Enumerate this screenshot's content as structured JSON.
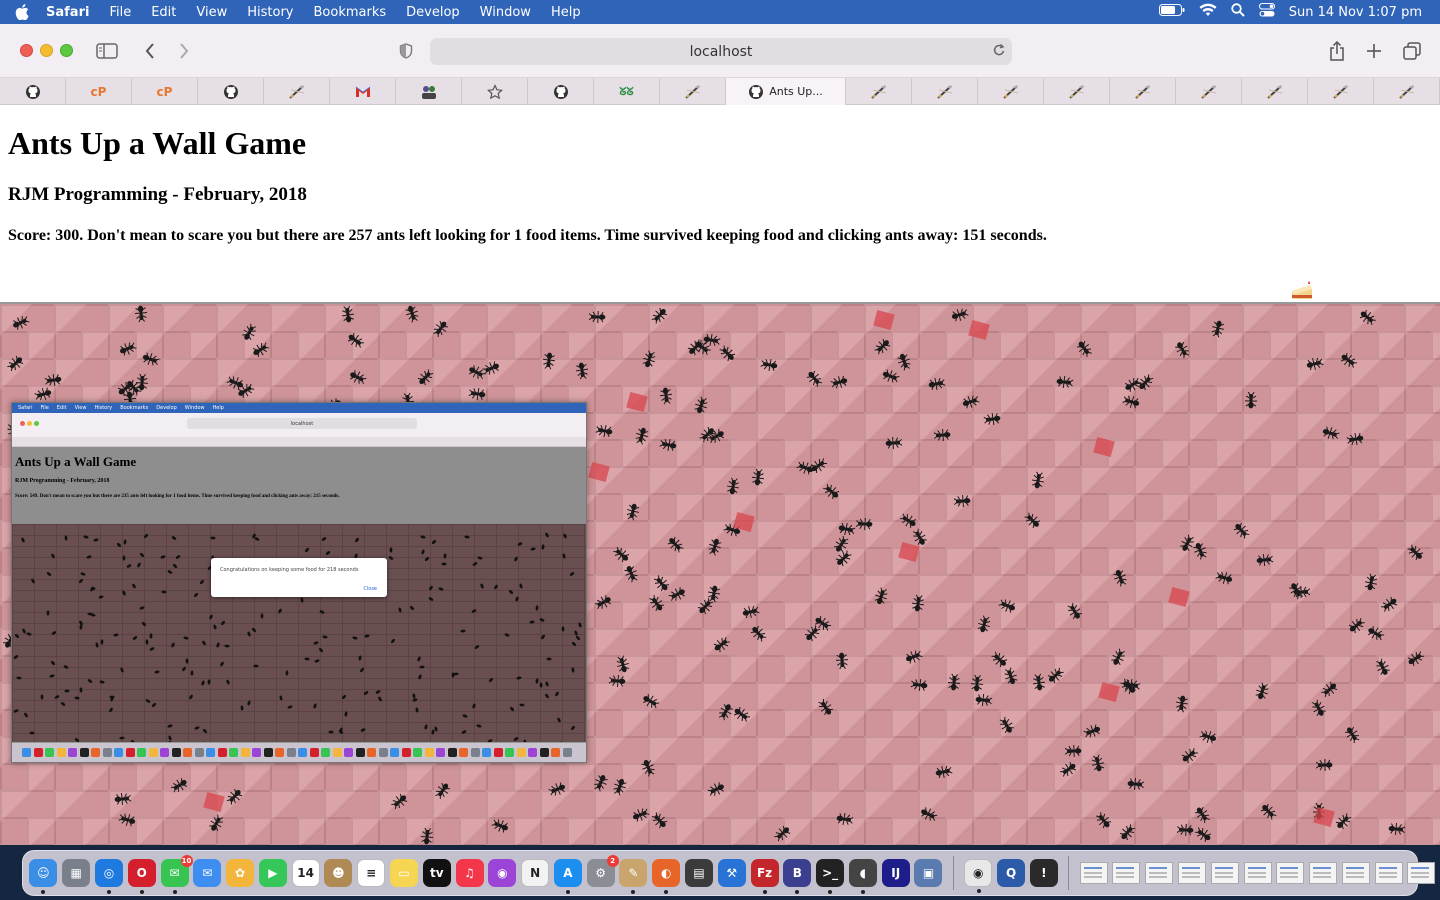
{
  "menubar": {
    "app": "Safari",
    "items": [
      "File",
      "Edit",
      "View",
      "History",
      "Bookmarks",
      "Develop",
      "Window",
      "Help"
    ],
    "datetime": "Sun 14 Nov  1:07 pm"
  },
  "toolbar": {
    "url": "localhost"
  },
  "tabs": [
    {
      "icon": "github-icon"
    },
    {
      "icon": "cpanel-icon",
      "text": "cP"
    },
    {
      "icon": "cpanel-icon",
      "text": "cP"
    },
    {
      "icon": "github-icon"
    },
    {
      "icon": "pencil-favicon-icon"
    },
    {
      "icon": "gmail-icon"
    },
    {
      "icon": "people-icon"
    },
    {
      "icon": "star-icon"
    },
    {
      "icon": "github-icon"
    },
    {
      "icon": "geeksforgeeks-icon"
    },
    {
      "icon": "pencil-favicon-icon"
    },
    {
      "icon": "github-icon",
      "label": "Ants Up...",
      "active": true
    },
    {
      "icon": "pencil-favicon-icon"
    },
    {
      "icon": "pencil-favicon-icon"
    },
    {
      "icon": "pencil-favicon-icon"
    },
    {
      "icon": "pencil-favicon-icon"
    },
    {
      "icon": "pencil-favicon-icon"
    },
    {
      "icon": "pencil-favicon-icon"
    },
    {
      "icon": "pencil-favicon-icon"
    },
    {
      "icon": "pencil-favicon-icon"
    },
    {
      "icon": "pencil-favicon-icon"
    }
  ],
  "page": {
    "title": "Ants Up a Wall Game",
    "subtitle": "RJM Programming - February, 2018",
    "score_text": "Score: 300. Don't mean to scare you but there are 257 ants left looking for 1 food items. Time survived keeping food and clicking ants away: 151 seconds.",
    "wall_color": "#d69a9f",
    "ant_color": "#1a1a1a"
  },
  "embedded_screenshot": {
    "menubar_items": [
      "Safari",
      "File",
      "Edit",
      "View",
      "History",
      "Bookmarks",
      "Develop",
      "Window",
      "Help"
    ],
    "url": "localhost",
    "title": "Ants Up a Wall Game",
    "subtitle": "RJM Programming - February, 2018",
    "score_text": "Score: 549. Don't mean to scare you but there are 235 ants left looking for 1 food items. Time survived keeping food and clicking ants away: 215 seconds.",
    "dialog_message": "Congratulations on keeping some food for 218 seconds",
    "dialog_close": "Close"
  },
  "dock": {
    "apps": [
      {
        "name": "finder-icon",
        "color": "#3a8ee6",
        "glyph": "☺",
        "running": true
      },
      {
        "name": "launchpad-icon",
        "color": "#7a7f8c",
        "glyph": "▦"
      },
      {
        "name": "safari-icon",
        "color": "#1f7ae0",
        "glyph": "◎",
        "running": true
      },
      {
        "name": "opera-icon",
        "color": "#d3202c",
        "glyph": "O",
        "running": true
      },
      {
        "name": "messages-icon",
        "color": "#37c453",
        "glyph": "✉",
        "badge": "10",
        "running": true
      },
      {
        "name": "mail-icon",
        "color": "#3d8ef0",
        "glyph": "✉"
      },
      {
        "name": "photos-icon",
        "color": "#f3b53c",
        "glyph": "✿"
      },
      {
        "name": "facetime-icon",
        "color": "#35c759",
        "glyph": "▶"
      },
      {
        "name": "calendar-icon",
        "color": "#ffffff",
        "glyph": "14",
        "dark_text": true
      },
      {
        "name": "contacts-icon",
        "color": "#b08a55",
        "glyph": "☻"
      },
      {
        "name": "reminders-icon",
        "color": "#ffffff",
        "glyph": "≡",
        "dark_text": true
      },
      {
        "name": "notes-icon",
        "color": "#f6d552",
        "glyph": "▭"
      },
      {
        "name": "appletv-icon",
        "color": "#111111",
        "glyph": "tv"
      },
      {
        "name": "music-icon",
        "color": "#f3364a",
        "glyph": "♫"
      },
      {
        "name": "podcasts-icon",
        "color": "#9b44d6",
        "glyph": "◉"
      },
      {
        "name": "news-icon",
        "color": "#f2f2f2",
        "glyph": "N",
        "dark_text": true
      },
      {
        "name": "appstore-icon",
        "color": "#1c8ef0",
        "glyph": "A",
        "running": true
      },
      {
        "name": "system-preferences-icon",
        "color": "#8a8d94",
        "glyph": "⚙",
        "badge": "2"
      },
      {
        "name": "paint-icon",
        "color": "#c9a56d",
        "glyph": "✎",
        "running": true
      },
      {
        "name": "firefox-icon",
        "color": "#e8652a",
        "glyph": "◐",
        "running": true
      },
      {
        "name": "calculator-icon",
        "color": "#3b3b3b",
        "glyph": "▤"
      },
      {
        "name": "xcode-icon",
        "color": "#2a73d6",
        "glyph": "⚒"
      },
      {
        "name": "filezilla-icon",
        "color": "#c3262b",
        "glyph": "Fz",
        "running": true
      },
      {
        "name": "bbedit-icon",
        "color": "#3b3f8f",
        "glyph": "B",
        "running": true
      },
      {
        "name": "terminal-icon",
        "color": "#222222",
        "glyph": ">_",
        "running": true
      },
      {
        "name": "elephant-icon",
        "color": "#444444",
        "glyph": "◖",
        "running": true
      },
      {
        "name": "intellij-icon",
        "color": "#1e1e8a",
        "glyph": "IJ"
      },
      {
        "name": "preview-icon",
        "color": "#5a7bb0",
        "glyph": "▣"
      }
    ],
    "apps2": [
      {
        "name": "chrome-icon",
        "color": "#e8e8e8",
        "glyph": "◉",
        "dark_text": true,
        "running": true
      },
      {
        "name": "quicktime-icon",
        "color": "#2b5aa8",
        "glyph": "Q"
      },
      {
        "name": "warning-log-icon",
        "color": "#2a2a2a",
        "glyph": "!"
      }
    ],
    "thumbnails": 11,
    "trash": "trash-icon"
  }
}
